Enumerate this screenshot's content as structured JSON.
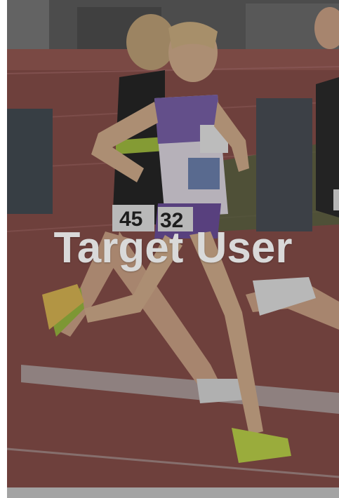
{
  "card": {
    "title": "Target User",
    "bar_color": "#a3a3a3",
    "title_color": "#d9d9d9"
  },
  "photo": {
    "icon": "runner-photo",
    "bib_numbers": [
      "45",
      "32"
    ]
  }
}
